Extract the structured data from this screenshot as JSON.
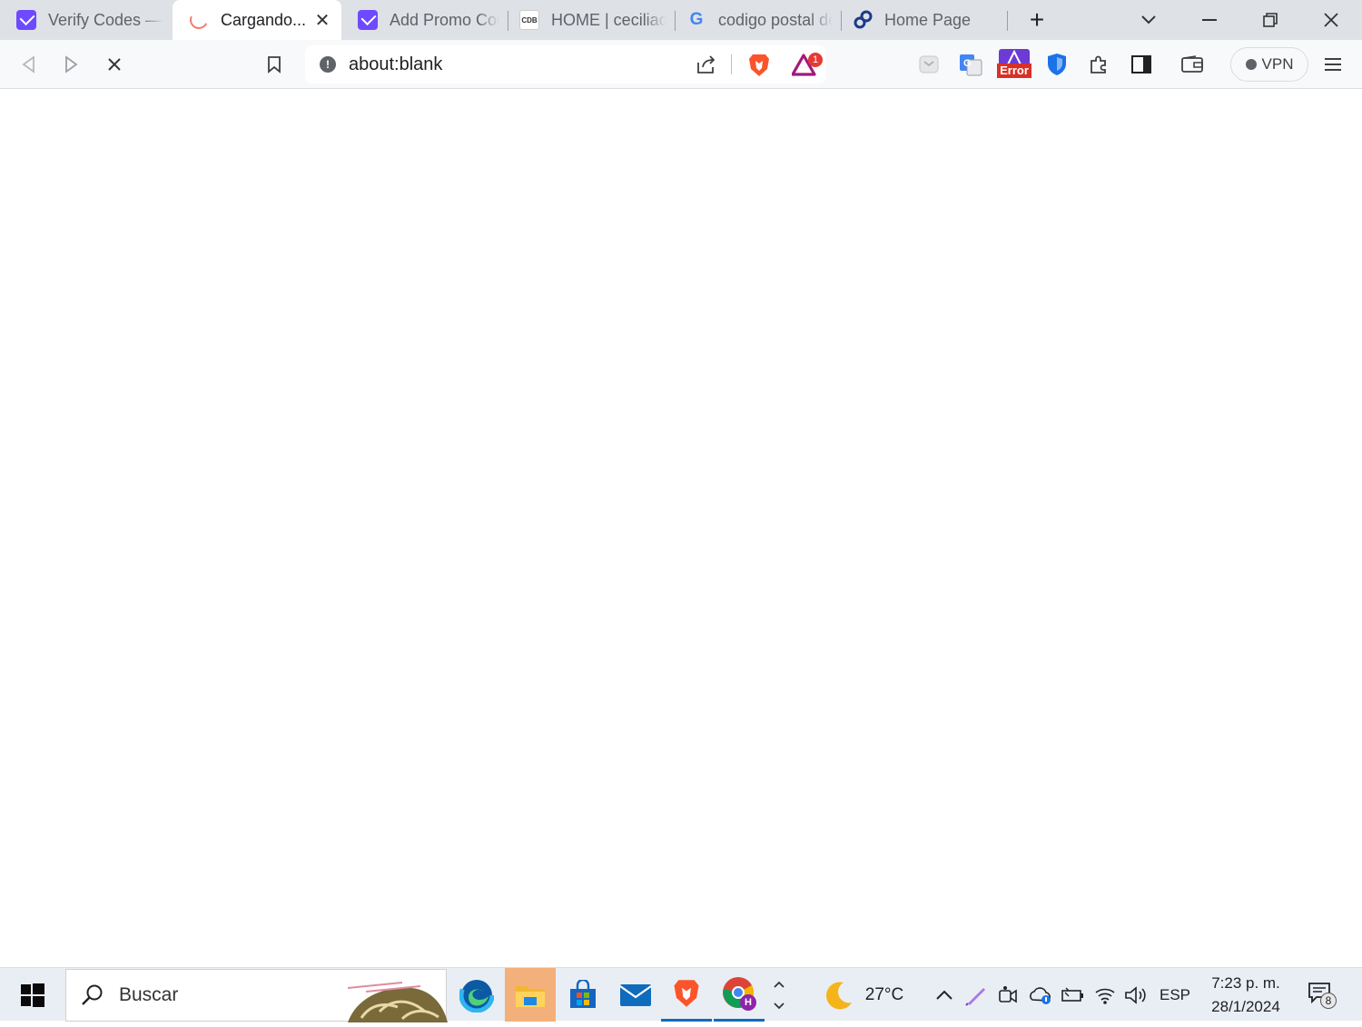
{
  "tabs": [
    {
      "title": "Verify Codes — S",
      "favicon": "proton-icon",
      "active": false
    },
    {
      "title": "Cargando...",
      "favicon": "loading-spinner-icon",
      "active": true,
      "close": "✕"
    },
    {
      "title": "Add Promo Code",
      "favicon": "proton-icon",
      "active": false
    },
    {
      "title": "HOME | ceciliade",
      "favicon": "cdb-icon",
      "favicon_text": "CDB",
      "active": false
    },
    {
      "title": "codigo postal de",
      "favicon": "google-icon",
      "favicon_text": "G",
      "active": false
    },
    {
      "title": "Home Page",
      "favicon": "link-icon",
      "active": false
    }
  ],
  "toolbar": {
    "url": "about:blank",
    "info_icon_text": "!",
    "rewards_badge": "1",
    "error_badge": "Error",
    "vpn_label": "VPN"
  },
  "taskbar": {
    "search_placeholder": "Buscar",
    "weather_temp": "27°C",
    "language": "ESP",
    "time": "7:23 p. m.",
    "date": "28/1/2024",
    "notification_count": "8"
  },
  "colors": {
    "tab_strip": "#dee1e6",
    "toolbar": "#f8f9fa",
    "brave_orange": "#fb542b",
    "proton_purple": "#6d4aff",
    "taskbar": "#e9eef5"
  }
}
